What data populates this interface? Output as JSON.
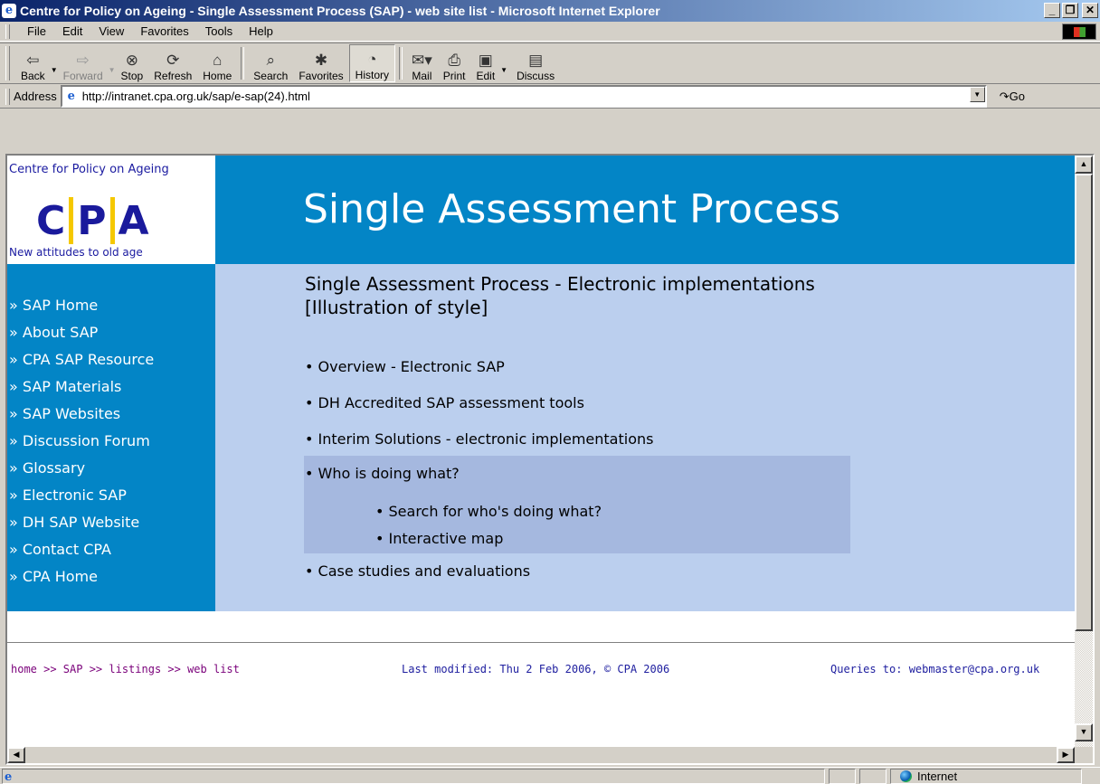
{
  "window": {
    "title": "Centre for Policy on Ageing - Single Assessment Process (SAP) - web site list - Microsoft Internet Explorer",
    "minimize": "_",
    "maximize": "❒",
    "close": "✕"
  },
  "menu": [
    "File",
    "Edit",
    "View",
    "Favorites",
    "Tools",
    "Help"
  ],
  "toolbar": {
    "back": "Back",
    "forward": "Forward",
    "stop": "Stop",
    "refresh": "Refresh",
    "home": "Home",
    "search": "Search",
    "favorites": "Favorites",
    "history": "History",
    "mail": "Mail",
    "print": "Print",
    "edit": "Edit",
    "discuss": "Discuss"
  },
  "address": {
    "label": "Address",
    "url": "http://intranet.cpa.org.uk/sap/e-sap(24).html",
    "go": "Go"
  },
  "logo": {
    "top": "Centre for Policy on Ageing",
    "letters": [
      "C",
      "P",
      "A"
    ],
    "bottom": "New attitudes to old age"
  },
  "banner": {
    "title": "Single Assessment Process"
  },
  "sidebar": {
    "items": [
      "» SAP Home",
      "» About SAP",
      "» CPA SAP Resource",
      "» SAP Materials",
      "» SAP Websites",
      "» Discussion Forum",
      "» Glossary",
      "» Electronic SAP",
      "» DH SAP Website",
      "» Contact CPA",
      "» CPA Home"
    ]
  },
  "main": {
    "title": "Single Assessment Process - Electronic implementations",
    "subtitle": "[Illustration of style]",
    "items": [
      "• Overview - Electronic SAP",
      "• DH Accredited SAP assessment tools",
      "• Interim Solutions - electronic implementations",
      "• Who is doing what?",
      "• Case studies and evaluations"
    ],
    "sub_items": [
      "• Search for who's doing what?",
      "• Interactive map"
    ]
  },
  "footer": {
    "breadcrumb": "home >> SAP >> listings >> web list",
    "modified": "Last modified: Thu 2 Feb 2006, © CPA 2006",
    "queries": "Queries to: webmaster@cpa.org.uk"
  },
  "status": {
    "zone": "Internet"
  },
  "colors": {
    "banner_blue": "#0385c6",
    "content_bg": "#bbcfee",
    "highlight_bg": "#a5b8df"
  }
}
